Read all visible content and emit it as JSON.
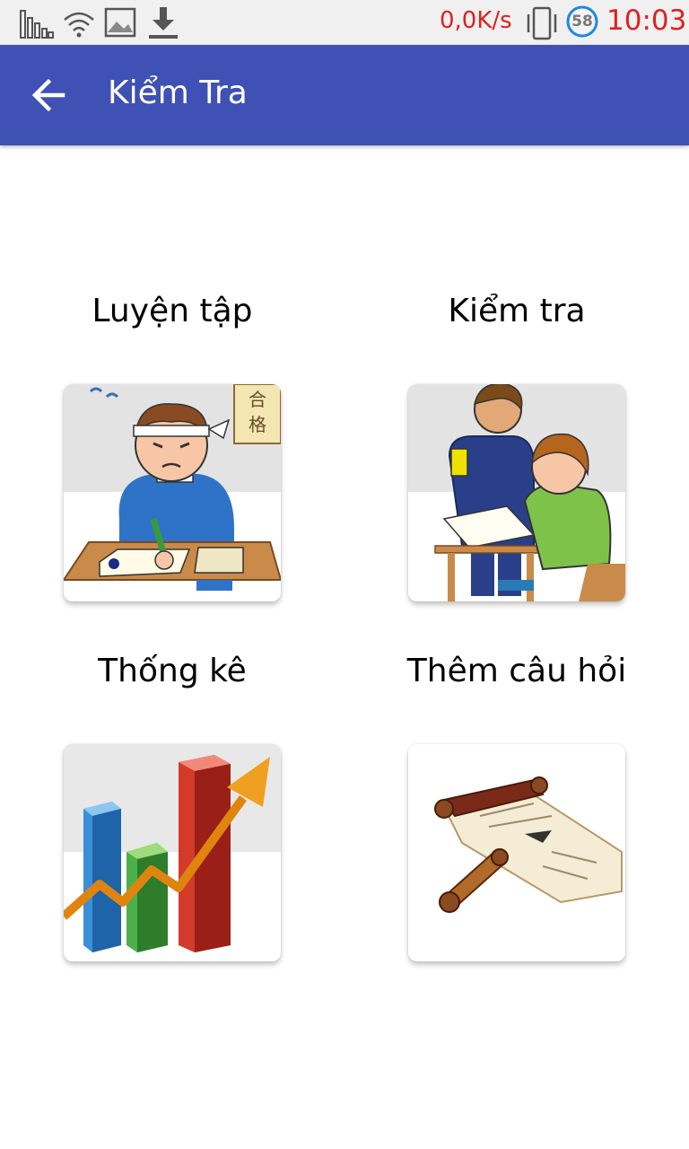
{
  "status_bar": {
    "net_speed": "0,0K/s",
    "battery_level": "58",
    "time": "10:03",
    "icons": [
      "signal-bars-icon",
      "wifi-icon",
      "image-icon",
      "download-icon",
      "vibrate-icon",
      "battery-circle-icon"
    ],
    "alert_color": "#e02020"
  },
  "app_bar": {
    "title": "Kiểm Tra",
    "back_icon": "arrow-back-icon",
    "color": "#3f51b5"
  },
  "menu": {
    "items": [
      {
        "label": "Luyện tập",
        "icon": "student-studying-icon"
      },
      {
        "label": "Kiểm tra",
        "icon": "exam-proctor-icon"
      },
      {
        "label": "Thống kê",
        "icon": "bar-chart-growth-icon"
      },
      {
        "label": "Thêm câu hỏi",
        "icon": "scroll-icon"
      }
    ]
  }
}
